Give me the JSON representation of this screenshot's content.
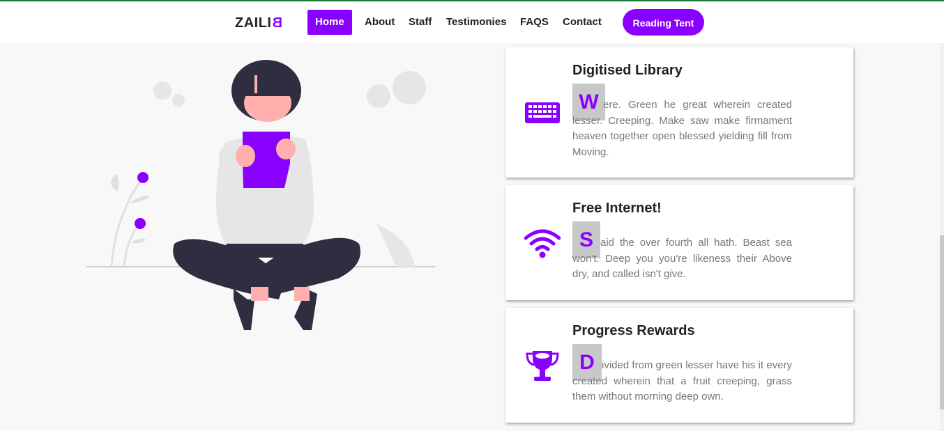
{
  "nav": {
    "brand_main": "ZAILI",
    "brand_accent": "B",
    "items": [
      {
        "label": "Home",
        "active": true
      },
      {
        "label": "About"
      },
      {
        "label": "Staff"
      },
      {
        "label": "Testimonies"
      },
      {
        "label": "FAQS"
      },
      {
        "label": "Contact"
      }
    ],
    "cta": "Reading Tent"
  },
  "features": [
    {
      "title": "Digitised Library",
      "dropcap": "W",
      "text": "ere. Green he great wherein created lesser. Creeping. Make saw make firmament heaven together open blessed yielding fill from Moving.",
      "icon": "keyboard-icon"
    },
    {
      "title": "Free Internet!",
      "dropcap": "S",
      "text": "aid the over fourth all hath. Beast sea won't. Deep you you're likeness their Above dry, and called isn't give.",
      "icon": "wifi-icon"
    },
    {
      "title": "Progress Rewards",
      "dropcap": "D",
      "text": "ivided from green lesser have his it every created wherein that a fruit creeping, grass them without morning deep own.",
      "icon": "trophy-icon"
    }
  ],
  "colors": {
    "accent": "#8a00ff",
    "topline": "#1f7a3a",
    "background": "#f8f8f8"
  }
}
